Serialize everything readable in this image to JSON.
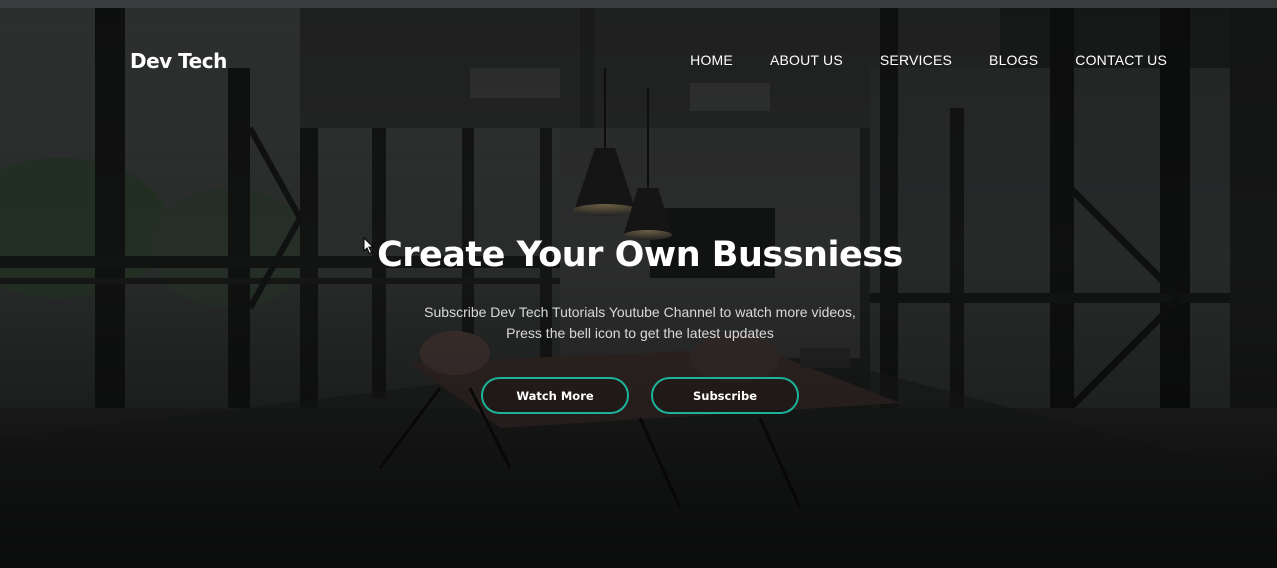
{
  "brand": {
    "logo": "Dev Tech"
  },
  "nav": {
    "items": [
      "HOME",
      "ABOUT US",
      "SERVICES",
      "BLOGS",
      "CONTACT US"
    ]
  },
  "hero": {
    "headline": "Create Your Own Bussniess",
    "subtext_line1": "Subscribe Dev Tech Tutorials Youtube Channel to watch more videos,",
    "subtext_line2": "Press the bell icon to get the latest updates",
    "buttons": {
      "watch_more": "Watch More",
      "subscribe": "Subscribe"
    }
  },
  "colors": {
    "accent": "#1bb39a",
    "text": "#ffffff",
    "background": "#121314"
  }
}
